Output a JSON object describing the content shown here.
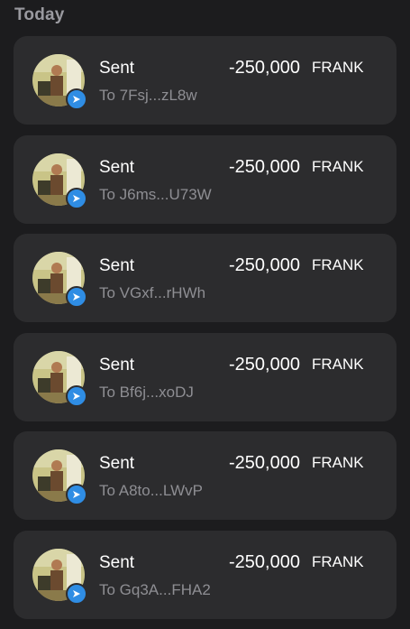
{
  "section": {
    "title": "Today"
  },
  "transactions": [
    {
      "type": "Sent",
      "recipient": "To 7Fsj...zL8w",
      "amount": "-250,000",
      "unit": "FRANK",
      "icon": "send-arrow-icon"
    },
    {
      "type": "Sent",
      "recipient": "To J6ms...U73W",
      "amount": "-250,000",
      "unit": "FRANK",
      "icon": "send-arrow-icon"
    },
    {
      "type": "Sent",
      "recipient": "To VGxf...rHWh",
      "amount": "-250,000",
      "unit": "FRANK",
      "icon": "send-arrow-icon"
    },
    {
      "type": "Sent",
      "recipient": "To Bf6j...xoDJ",
      "amount": "-250,000",
      "unit": "FRANK",
      "icon": "send-arrow-icon"
    },
    {
      "type": "Sent",
      "recipient": "To A8to...LWvP",
      "amount": "-250,000",
      "unit": "FRANK",
      "icon": "send-arrow-icon"
    },
    {
      "type": "Sent",
      "recipient": "To Gq3A...FHA2",
      "amount": "-250,000",
      "unit": "FRANK",
      "icon": "send-arrow-icon"
    }
  ],
  "colors": {
    "background": "#1c1c1e",
    "card": "#2c2c2e",
    "accent": "#2f8de4",
    "muted_text": "#8e8e93"
  }
}
